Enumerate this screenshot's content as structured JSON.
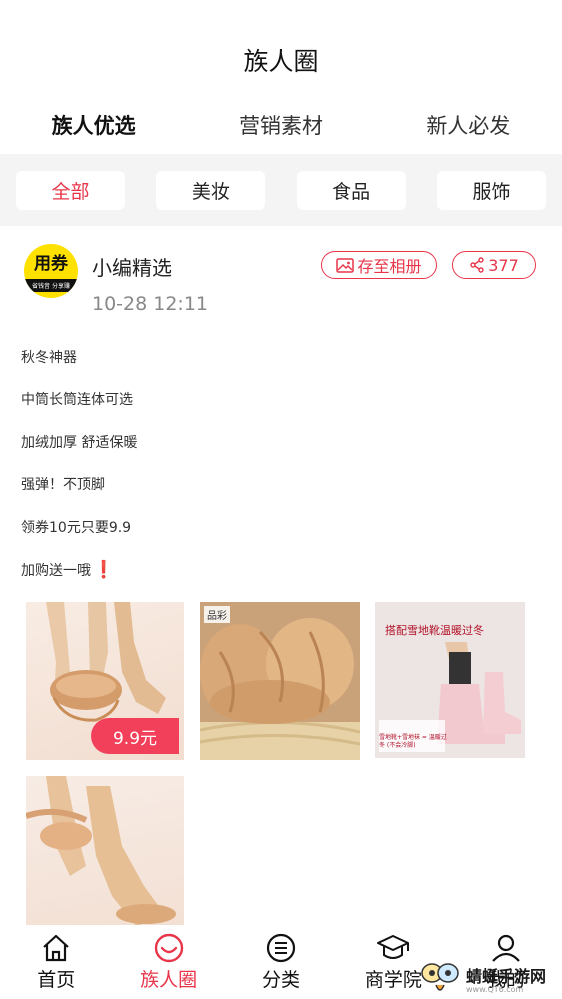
{
  "header": {
    "title": "族人圈"
  },
  "top_tabs": [
    {
      "label": "族人优选",
      "active": true
    },
    {
      "label": "营销素材",
      "active": false
    },
    {
      "label": "新人必发",
      "active": false
    }
  ],
  "filters": [
    {
      "label": "全部",
      "active": true
    },
    {
      "label": "美妆",
      "active": false
    },
    {
      "label": "食品",
      "active": false
    },
    {
      "label": "服饰",
      "active": false
    }
  ],
  "post": {
    "avatar_logo": "用券",
    "avatar_strip": "省钱音 分享赚",
    "author": "小编精选",
    "time": "10-28 12:11",
    "save_label": "存至相册",
    "share_count": "377",
    "lines": [
      "秋冬神器",
      "中筒长筒连体可选",
      "加绒加厚 舒适保暖",
      "强弹！不顶脚",
      "领券10元只要9.9",
      "加购送一哦"
    ],
    "exclaim": "❗",
    "price_badge": "9.9元",
    "img2_brand": "品彩",
    "img3_caption": "搭配雪地靴温暖过冬",
    "img3_note": "雪地靴+雪地袜 = 温暖过冬 (不会冷脚)"
  },
  "bottom_nav": [
    {
      "label": "首页",
      "icon": "home-icon",
      "active": false
    },
    {
      "label": "族人圈",
      "icon": "chat-bubble-icon",
      "active": true
    },
    {
      "label": "分类",
      "icon": "menu-list-icon",
      "active": false
    },
    {
      "label": "商学院",
      "icon": "graduation-cap-icon",
      "active": false
    },
    {
      "label": "我的",
      "icon": "user-icon",
      "active": false
    }
  ],
  "watermark": {
    "title": "蜻蜓手游网",
    "url": "www.QT6.com"
  },
  "colors": {
    "accent": "#e8354a",
    "band": "#f4f4f4"
  }
}
